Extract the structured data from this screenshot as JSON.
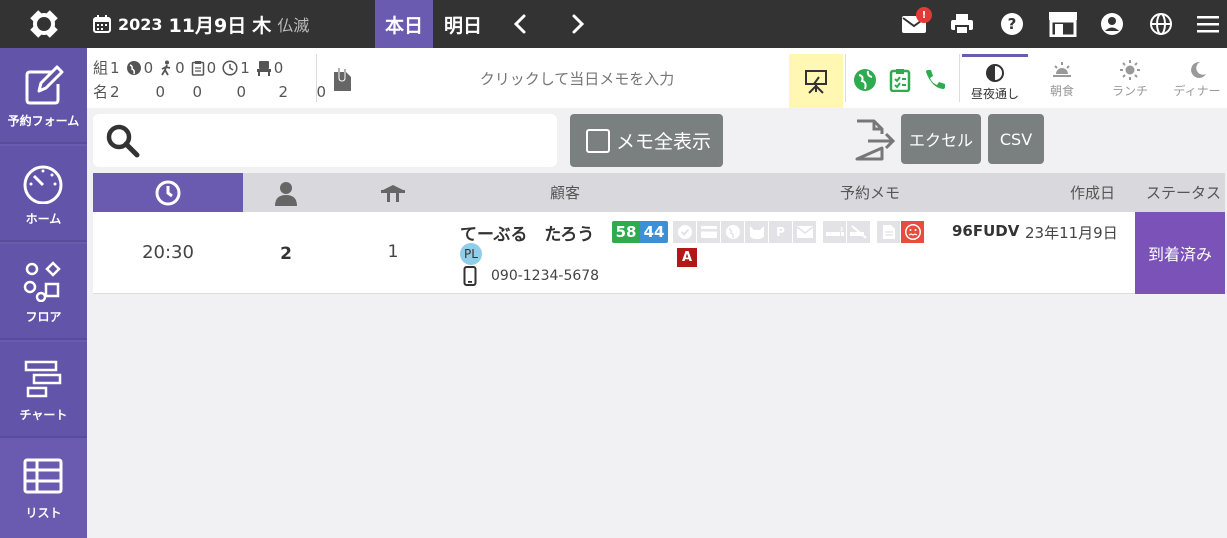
{
  "header": {
    "year": "2023",
    "month_day": "11月9日",
    "weekday": "木",
    "rokuyo": "仏滅",
    "today_label": "本日",
    "tomorrow_label": "明日",
    "mail_badge_count": "!"
  },
  "sidebar": {
    "items": [
      {
        "label": "予約フォーム",
        "icon": "pencil-square-icon"
      },
      {
        "label": "ホーム",
        "icon": "gauge-icon"
      },
      {
        "label": "フロア",
        "icon": "floor-shapes-icon"
      },
      {
        "label": "チャート",
        "icon": "chart-icon"
      },
      {
        "label": "リスト",
        "icon": "table-list-icon"
      }
    ]
  },
  "summary": {
    "groups_label": "組",
    "people_label": "名",
    "group_counts": [
      "1",
      "0",
      "0",
      "0",
      "1",
      "0"
    ],
    "people_counts": [
      "2",
      "0",
      "0",
      "0",
      "2",
      "0"
    ],
    "memo_placeholder": "クリックして当日メモを入力",
    "meal_tabs": [
      {
        "label": "昼夜通し",
        "icon": "half-circle-icon"
      },
      {
        "label": "朝食",
        "icon": "sunrise-icon"
      },
      {
        "label": "ランチ",
        "icon": "sun-icon"
      },
      {
        "label": "ディナー",
        "icon": "moon-icon"
      }
    ]
  },
  "toolbar": {
    "memo_all_label": "メモ全表示",
    "excel_label": "エクセル",
    "csv_label": "CSV"
  },
  "table": {
    "headers": {
      "customer": "顧客",
      "memo": "予約メモ",
      "created": "作成日",
      "status": "ステータス"
    },
    "rows": [
      {
        "time": "20:30",
        "pax": "2",
        "tables": "1",
        "name": "てーぶる　たろう",
        "badge": "PL",
        "phone": "090-1234-5678",
        "tag_a": "58",
        "tag_b": "44",
        "flag": "A",
        "code": "96FUDV",
        "created": "23年11月9日",
        "status": "到着済み"
      }
    ]
  },
  "colors": {
    "accent": "#6a5bb0",
    "topbar": "#333333",
    "status": "#7a52b8",
    "green": "#2eaa4f",
    "blue": "#3d8fd6",
    "red": "#b21818"
  }
}
